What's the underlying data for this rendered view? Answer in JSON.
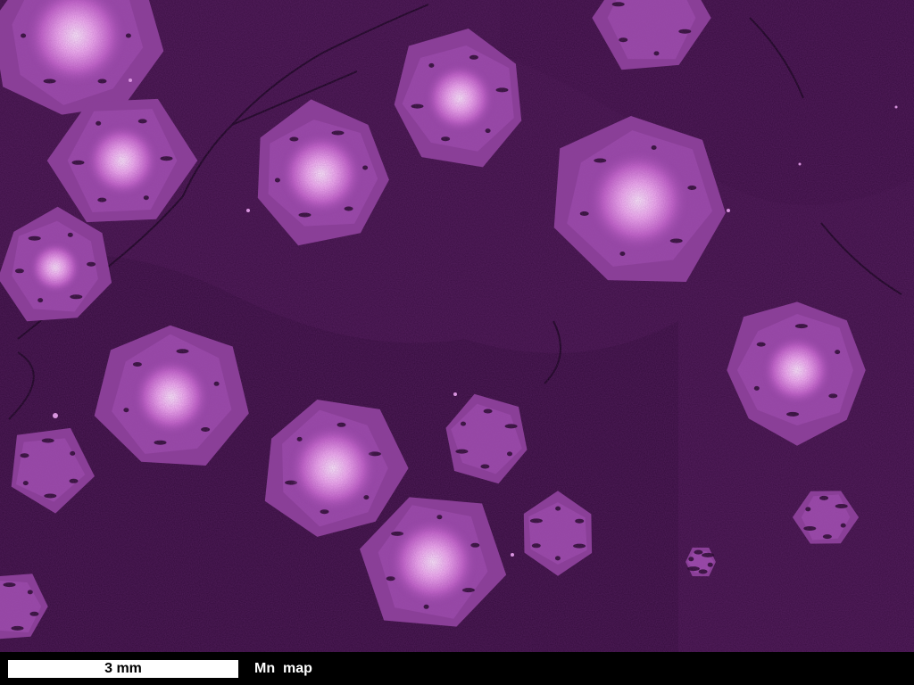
{
  "image": {
    "description_tag": "element-map",
    "colors": {
      "matrix": "#3a0f42",
      "matrix_dark": "#2a0832",
      "rim": "#8a3f98",
      "mantle": "#a04eb0",
      "core_glow": "#ffe6ff",
      "core_mid": "#e48ae8",
      "vein": "#1a0420"
    }
  },
  "footer": {
    "scale_bar_label": "3 mm",
    "map_label": "Mn  map"
  }
}
